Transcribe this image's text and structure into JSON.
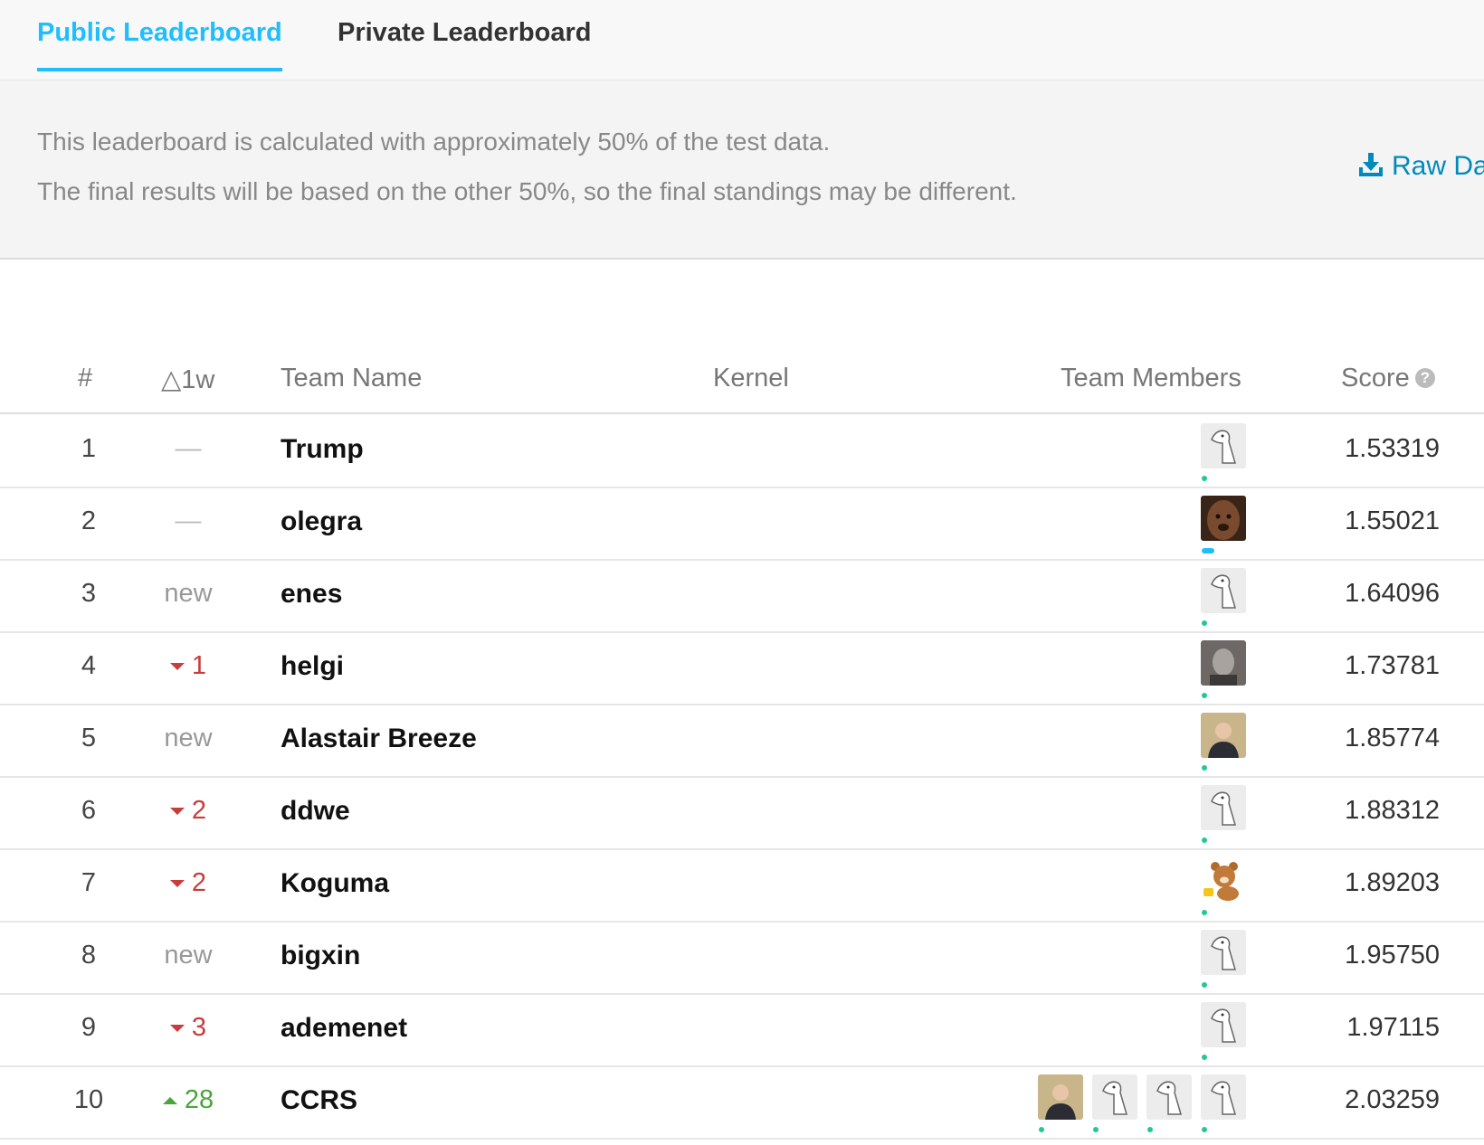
{
  "tabs": {
    "public": "Public Leaderboard",
    "private": "Private Leaderboard"
  },
  "info": {
    "line1": "This leaderboard is calculated with approximately 50% of the test data.",
    "line2": "The final results will be based on the other 50%, so the final standings may be different.",
    "raw_data": "Raw Da"
  },
  "columns": {
    "rank": "#",
    "change": "△1w",
    "team": "Team Name",
    "kernel": "Kernel",
    "members": "Team Members",
    "score": "Score"
  },
  "rows": [
    {
      "rank": "1",
      "change": "—",
      "change_kind": "none",
      "team": "Trump",
      "score": "1.53319",
      "avatars": [
        "default"
      ]
    },
    {
      "rank": "2",
      "change": "—",
      "change_kind": "none",
      "team": "olegra",
      "score": "1.55021",
      "avatars": [
        "wookiee"
      ]
    },
    {
      "rank": "3",
      "change": "new",
      "change_kind": "new",
      "team": "enes",
      "score": "1.64096",
      "avatars": [
        "default"
      ]
    },
    {
      "rank": "4",
      "change": "1",
      "change_kind": "down",
      "team": "helgi",
      "score": "1.73781",
      "avatars": [
        "masked-face"
      ]
    },
    {
      "rank": "5",
      "change": "new",
      "change_kind": "new",
      "team": "Alastair Breeze",
      "score": "1.85774",
      "avatars": [
        "photo-person"
      ]
    },
    {
      "rank": "6",
      "change": "2",
      "change_kind": "down",
      "team": "ddwe",
      "score": "1.88312",
      "avatars": [
        "default"
      ]
    },
    {
      "rank": "7",
      "change": "2",
      "change_kind": "down",
      "team": "Koguma",
      "score": "1.89203",
      "avatars": [
        "bear"
      ]
    },
    {
      "rank": "8",
      "change": "new",
      "change_kind": "new",
      "team": "bigxin",
      "score": "1.95750",
      "avatars": [
        "default"
      ]
    },
    {
      "rank": "9",
      "change": "3",
      "change_kind": "down",
      "team": "ademenet",
      "score": "1.97115",
      "avatars": [
        "default"
      ]
    },
    {
      "rank": "10",
      "change": "28",
      "change_kind": "up",
      "team": "CCRS",
      "score": "2.03259",
      "avatars": [
        "photo-person",
        "default",
        "default",
        "default"
      ]
    }
  ],
  "colors": {
    "accent": "#20beff",
    "down": "#c83c3c",
    "up": "#4ba43c",
    "link": "#008abc"
  }
}
